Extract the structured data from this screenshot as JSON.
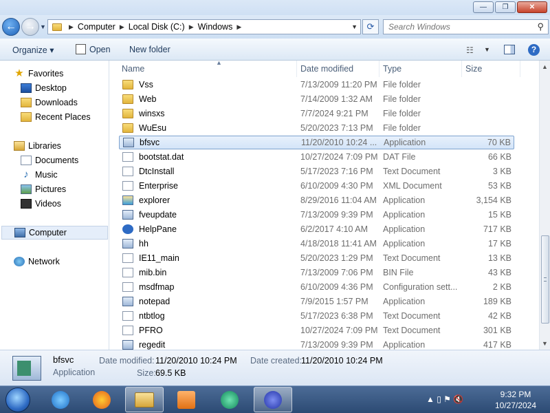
{
  "window": {
    "minimize_glyph": "—",
    "maximize_glyph": "❐",
    "close_glyph": "✕"
  },
  "navigation": {
    "back_glyph": "←",
    "forward_glyph": "→",
    "breadcrumbs": [
      "Computer",
      "Local Disk (C:)",
      "Windows"
    ],
    "search_placeholder": "Search Windows",
    "refresh_glyph": "⟳",
    "search_glyph": "⚲"
  },
  "toolbar": {
    "organize_label": "Organize ▾",
    "open_label": "Open",
    "new_folder_label": "New folder"
  },
  "sidebar": {
    "favorites": {
      "label": "Favorites",
      "icon": "star-icon"
    },
    "favorite_items": [
      {
        "label": "Desktop",
        "icon": "desktop-icon"
      },
      {
        "label": "Downloads",
        "icon": "downloads-folder-icon"
      },
      {
        "label": "Recent Places",
        "icon": "recent-places-icon"
      }
    ],
    "libraries": {
      "label": "Libraries",
      "icon": "libraries-icon"
    },
    "library_items": [
      {
        "label": "Documents",
        "icon": "documents-icon"
      },
      {
        "label": "Music",
        "icon": "music-icon"
      },
      {
        "label": "Pictures",
        "icon": "pictures-icon"
      },
      {
        "label": "Videos",
        "icon": "videos-icon"
      }
    ],
    "computer": {
      "label": "Computer",
      "icon": "computer-icon"
    },
    "network": {
      "label": "Network",
      "icon": "network-icon"
    }
  },
  "columns": {
    "name": "Name",
    "date": "Date modified",
    "type": "Type",
    "size": "Size"
  },
  "files": [
    {
      "name": "Vss",
      "date": "7/13/2009 11:20 PM",
      "type": "File folder",
      "size": "",
      "icon": "folder"
    },
    {
      "name": "Web",
      "date": "7/14/2009 1:32 AM",
      "type": "File folder",
      "size": "",
      "icon": "folder"
    },
    {
      "name": "winsxs",
      "date": "7/7/2024 9:21 PM",
      "type": "File folder",
      "size": "",
      "icon": "folder"
    },
    {
      "name": "WuEsu",
      "date": "5/20/2023 7:13 PM",
      "type": "File folder",
      "size": "",
      "icon": "folder"
    },
    {
      "name": "bfsvc",
      "date": "11/20/2010 10:24 ...",
      "type": "Application",
      "size": "70 KB",
      "icon": "app"
    },
    {
      "name": "bootstat.dat",
      "date": "10/27/2024 7:09 PM",
      "type": "DAT File",
      "size": "66 KB",
      "icon": "doc"
    },
    {
      "name": "DtcInstall",
      "date": "5/17/2023 7:16 PM",
      "type": "Text Document",
      "size": "3 KB",
      "icon": "doc"
    },
    {
      "name": "Enterprise",
      "date": "6/10/2009 4:30 PM",
      "type": "XML Document",
      "size": "53 KB",
      "icon": "doc"
    },
    {
      "name": "explorer",
      "date": "8/29/2016 11:04 AM",
      "type": "Application",
      "size": "3,154 KB",
      "icon": "exp"
    },
    {
      "name": "fveupdate",
      "date": "7/13/2009 9:39 PM",
      "type": "Application",
      "size": "15 KB",
      "icon": "app"
    },
    {
      "name": "HelpPane",
      "date": "6/2/2017 4:10 AM",
      "type": "Application",
      "size": "717 KB",
      "icon": "help"
    },
    {
      "name": "hh",
      "date": "4/18/2018 11:41 AM",
      "type": "Application",
      "size": "17 KB",
      "icon": "app"
    },
    {
      "name": "IE11_main",
      "date": "5/20/2023 1:29 PM",
      "type": "Text Document",
      "size": "13 KB",
      "icon": "doc"
    },
    {
      "name": "mib.bin",
      "date": "7/13/2009 7:06 PM",
      "type": "BIN File",
      "size": "43 KB",
      "icon": "doc"
    },
    {
      "name": "msdfmap",
      "date": "6/10/2009 4:36 PM",
      "type": "Configuration sett...",
      "size": "2 KB",
      "icon": "doc"
    },
    {
      "name": "notepad",
      "date": "7/9/2015 1:57 PM",
      "type": "Application",
      "size": "189 KB",
      "icon": "app"
    },
    {
      "name": "ntbtlog",
      "date": "5/17/2023 6:38 PM",
      "type": "Text Document",
      "size": "42 KB",
      "icon": "doc"
    },
    {
      "name": "PFRO",
      "date": "10/27/2024 7:09 PM",
      "type": "Text Document",
      "size": "301 KB",
      "icon": "doc"
    },
    {
      "name": "regedit",
      "date": "7/13/2009 9:39 PM",
      "type": "Application",
      "size": "417 KB",
      "icon": "app"
    }
  ],
  "selected_index": 4,
  "details": {
    "name": "bfsvc",
    "type": "Application",
    "modified_label": "Date modified:",
    "modified_value": "11/20/2010 10:24 PM",
    "created_label": "Date created:",
    "created_value": "11/20/2010 10:24 PM",
    "size_label": "Size:",
    "size_value": "69.5 KB"
  },
  "taskbar": {
    "apps": [
      {
        "name": "internet-explorer",
        "active": false
      },
      {
        "name": "firefox",
        "active": false
      },
      {
        "name": "windows-explorer",
        "active": true
      },
      {
        "name": "media-player",
        "active": false
      },
      {
        "name": "app-green",
        "active": false
      },
      {
        "name": "app-infinity",
        "active": true
      }
    ],
    "tray_glyphs": "▲ ▯ ⚑ 🔇",
    "time": "9:32 PM",
    "date": "10/27/2024"
  },
  "colors": {
    "selection": "#d3e4f8",
    "selection_border": "#7da2ce",
    "taskbar": "#2c4a73"
  }
}
